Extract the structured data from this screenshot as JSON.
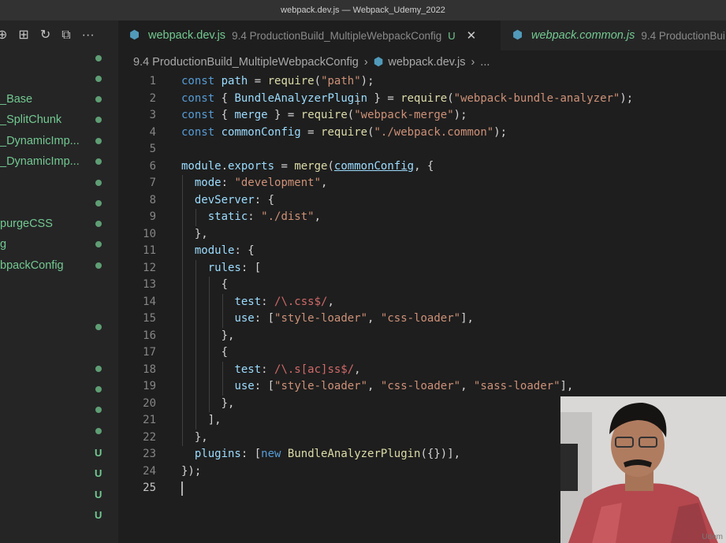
{
  "window": {
    "title": "webpack.dev.js — Webpack_Udemy_2022"
  },
  "explorer": {
    "toolbar": [
      {
        "name": "new-file-icon",
        "glyph": "⊕"
      },
      {
        "name": "new-folder-icon",
        "glyph": "⊞"
      },
      {
        "name": "refresh-icon",
        "glyph": "↻"
      },
      {
        "name": "collapse-all-icon",
        "glyph": "⧉"
      },
      {
        "name": "more-actions-icon",
        "glyph": "···"
      }
    ],
    "items": [
      {
        "label": "_Base"
      },
      {
        "label": "_SplitChunk"
      },
      {
        "label": "_DynamicImp..."
      },
      {
        "label": "_DynamicImp..."
      },
      {
        "label": "purgeCSS"
      },
      {
        "label": "g"
      },
      {
        "label": "bpackConfig"
      }
    ],
    "badges": [
      "U",
      "U",
      "U",
      "U"
    ]
  },
  "tabs": [
    {
      "name": "webpack.dev.js",
      "description": "9.4 ProductionBuild_MultipleWebpackConfig",
      "status": "U",
      "close": "✕"
    },
    {
      "name": "webpack.common.js",
      "description": "9.4 ProductionBui"
    }
  ],
  "breadcrumb": {
    "folder": "9.4 ProductionBuild_MultipleWebpackConfig",
    "file": "webpack.dev.js",
    "more": "..."
  },
  "editor": {
    "line_numbers": [
      "1",
      "2",
      "3",
      "4",
      "5",
      "6",
      "7",
      "8",
      "9",
      "10",
      "11",
      "12",
      "13",
      "14",
      "15",
      "16",
      "17",
      "18",
      "19",
      "20",
      "21",
      "22",
      "23",
      "24",
      "25"
    ],
    "current_line": 25
  },
  "webcam": {
    "label": "Udem"
  }
}
